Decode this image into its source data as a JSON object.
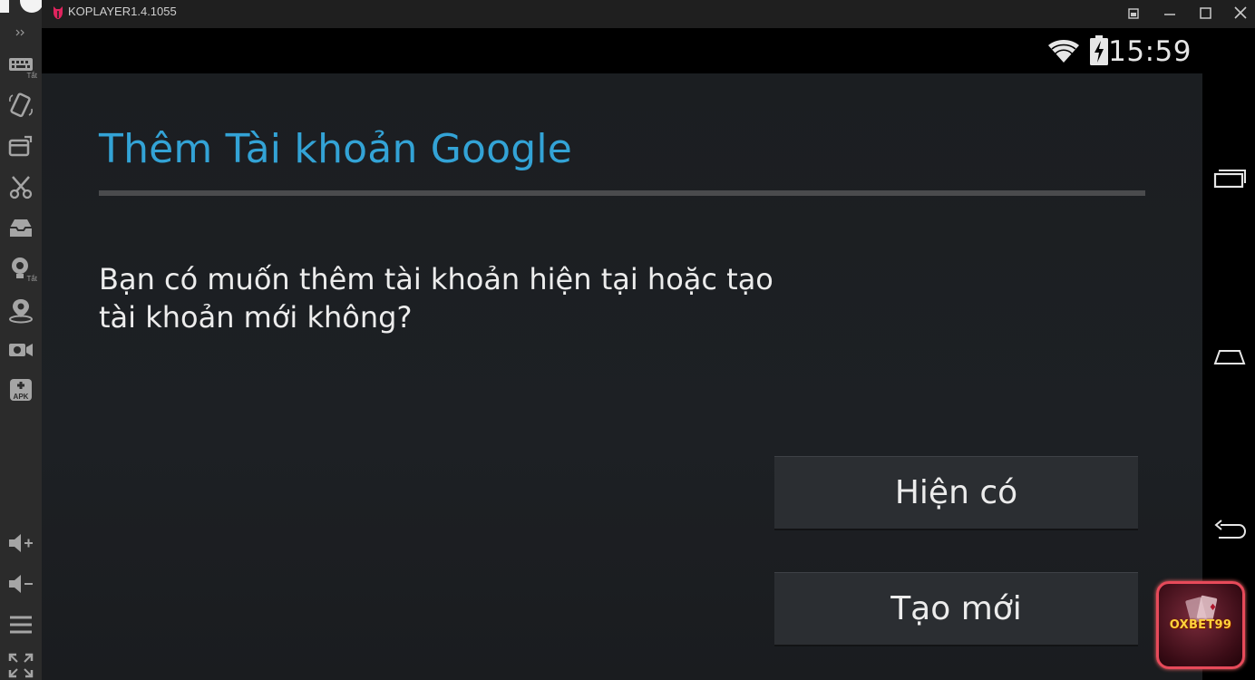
{
  "window": {
    "app_title": "KOPLAYER1.4.1055"
  },
  "toolbar": {
    "items": [
      {
        "icon": "keyboard-icon",
        "sub": "Tắt"
      },
      {
        "icon": "rotate-icon",
        "sub": ""
      },
      {
        "icon": "screenshot-icon",
        "sub": ""
      },
      {
        "icon": "scissors-icon",
        "sub": ""
      },
      {
        "icon": "inbox-icon",
        "sub": ""
      },
      {
        "icon": "webcam-icon",
        "sub": "Tắt"
      },
      {
        "icon": "location-pin-icon",
        "sub": ""
      },
      {
        "icon": "video-record-icon",
        "sub": ""
      },
      {
        "icon": "apk-install-icon",
        "sub": ""
      },
      {
        "icon": "volume-up-icon",
        "sub": ""
      },
      {
        "icon": "volume-down-icon",
        "sub": ""
      },
      {
        "icon": "menu-icon",
        "sub": ""
      },
      {
        "icon": "fullscreen-icon",
        "sub": ""
      }
    ],
    "apk_label": "APK"
  },
  "status": {
    "time": "15:59"
  },
  "dialog": {
    "title": "Thêm Tài khoản Google",
    "message": "Bạn có muốn thêm tài khoản hiện tại hoặc tạo tài khoản mới không?",
    "buttons": {
      "existing": "Hiện có",
      "new": "Tạo mới"
    }
  },
  "badge": {
    "text": "OXBET99"
  },
  "colors": {
    "title_accent": "#33a3d6",
    "badge_border": "#e74a5a",
    "badge_text": "#ffd23b"
  }
}
